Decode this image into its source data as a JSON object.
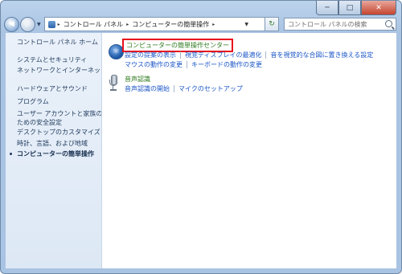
{
  "window": {
    "min_glyph": "─",
    "max_glyph": "□",
    "close_glyph": "✕"
  },
  "nav": {
    "back_glyph": "◀",
    "forward_glyph": "▶",
    "dropdown_glyph": "▼",
    "breadcrumb": [
      "コントロール パネル",
      "コンピューターの簡単操作"
    ],
    "separator_glyph": "▸",
    "refresh_glyph": "↻",
    "search_placeholder": "コントロール パネルの検索"
  },
  "sidebar": {
    "home": "コントロール パネル ホーム",
    "items": [
      "システムとセキュリティ",
      "ネットワークとインターネット",
      "ハードウェアとサウンド",
      "プログラム",
      "ユーザー アカウントと家族の",
      "ための安全設定",
      "デスクトップのカスタマイズ",
      "時計、言語、および地域",
      "コンピューターの簡単操作"
    ]
  },
  "main": {
    "ease_center": {
      "icon": "ease-of-access-icon",
      "title": "コンピューターの簡単操作センター",
      "links_row1": [
        "設定の提案の表示",
        "視覚ディスプレイの最適化",
        "音を視覚的な合図に置き換える設定"
      ],
      "links_row2": [
        "マウスの動作の変更",
        "キーボードの動作の変更"
      ]
    },
    "speech": {
      "icon": "microphone-icon",
      "title": "音声認識",
      "links": [
        "音声認識の開始",
        "マイクのセットアップ"
      ]
    }
  },
  "colors": {
    "link_blue": "#1a55c7",
    "heading_green": "#2d7a1e",
    "highlight_red": "#e8111c"
  }
}
